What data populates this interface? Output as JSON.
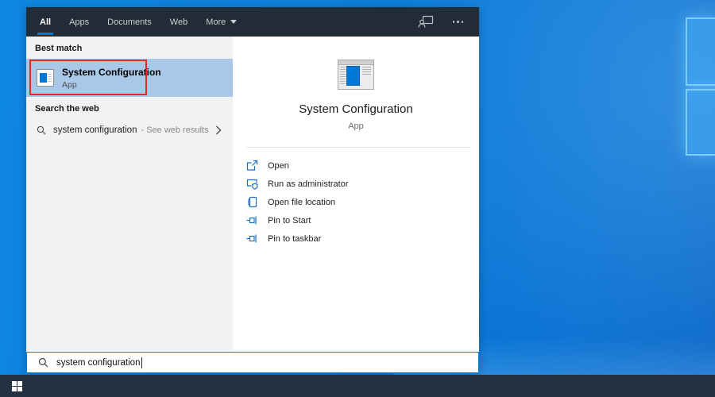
{
  "colors": {
    "accent": "#0078d7",
    "highlight": "#a9c8e8",
    "annotation_red": "#e22b1e",
    "topbar_bg": "#212c36",
    "taskbar_bg": "#243140",
    "desktop_blue_light": "#0f86e0",
    "icon_blue": "#1a6fc4"
  },
  "tabs": {
    "items": [
      {
        "label": "All",
        "active": true
      },
      {
        "label": "Apps",
        "active": false
      },
      {
        "label": "Documents",
        "active": false
      },
      {
        "label": "Web",
        "active": false
      },
      {
        "label": "More",
        "active": false,
        "icon": "chevron-down-icon"
      }
    ],
    "right_icons": [
      {
        "name": "account-icon"
      },
      {
        "name": "ellipsis-icon"
      }
    ]
  },
  "left_panel": {
    "best_match_header": "Best match",
    "best_match": {
      "title": "System Configuration",
      "subtitle": "App",
      "icon": "system-configuration-app-icon",
      "annotated": true
    },
    "search_web_header": "Search the web",
    "web_suggestion": {
      "icon": "search-icon",
      "query": "system configuration",
      "suffix": "- See web results",
      "chevron": "chevron-right-icon"
    }
  },
  "right_panel": {
    "app_icon": "system-configuration-app-icon",
    "app_title": "System Configuration",
    "app_subtitle": "App",
    "actions": [
      {
        "label": "Open",
        "icon": "open-icon"
      },
      {
        "label": "Run as administrator",
        "icon": "admin-shield-icon"
      },
      {
        "label": "Open file location",
        "icon": "file-location-icon"
      },
      {
        "label": "Pin to Start",
        "icon": "pin-icon"
      },
      {
        "label": "Pin to taskbar",
        "icon": "pin-icon"
      }
    ]
  },
  "search_box": {
    "icon": "search-icon",
    "value": "system configuration"
  },
  "taskbar": {
    "start_icon": "windows-logo-icon"
  }
}
